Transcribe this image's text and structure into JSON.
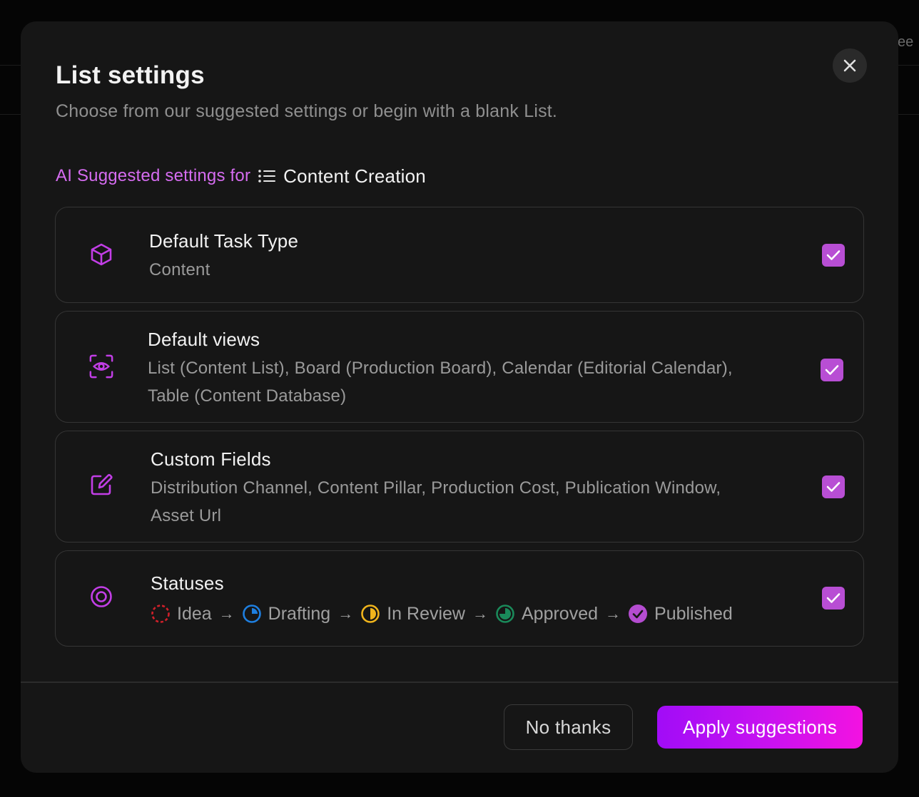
{
  "background": {
    "peek_text": "ee"
  },
  "modal": {
    "title": "List settings",
    "subtitle": "Choose from our suggested settings or begin with a blank List.",
    "ai_label": "AI Suggested settings for",
    "list_name": "Content Creation"
  },
  "cards": {
    "task_type": {
      "title": "Default Task Type",
      "desc": "Content",
      "checked": true
    },
    "views": {
      "title": "Default views",
      "desc_line1": "List (Content List), Board (Production Board), Calendar (Editorial Calendar),",
      "desc_line2": "Table (Content Database)",
      "checked": true
    },
    "fields": {
      "title": "Custom Fields",
      "desc_line1": "Distribution Channel, Content Pillar, Production Cost, Publication Window,",
      "desc_line2": "Asset Url",
      "checked": true
    },
    "statuses": {
      "title": "Statuses",
      "items": [
        "Idea",
        "Drafting",
        "In Review",
        "Approved",
        "Published"
      ],
      "arrow": "→",
      "checked": true
    }
  },
  "colors": {
    "accent": "#b84ed4",
    "ai_label": "#d56cf0",
    "status_idea": "#d0202a",
    "status_drafting": "#1e7fe0",
    "status_review": "#f0b41c",
    "status_approved": "#1a8a5a",
    "status_published": "#b44cd0"
  },
  "footer": {
    "no_thanks": "No thanks",
    "apply": "Apply suggestions"
  }
}
